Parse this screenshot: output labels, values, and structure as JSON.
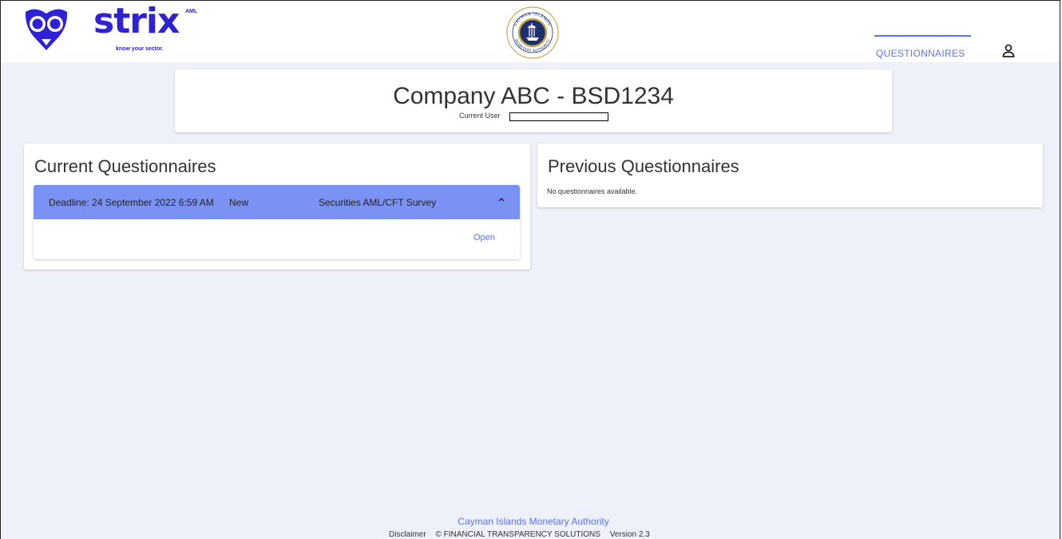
{
  "brand": {
    "name": "strix",
    "superscript": "AML",
    "tagline": "know your sector.",
    "color": "#2e21d6"
  },
  "seal": {
    "top_text": "CAYMAN ISLANDS",
    "bottom_text": "MONETARY AUTHORITY"
  },
  "nav": {
    "questionnaires_label": "QUESTIONNAIRES",
    "accent": "#5b73ea",
    "user_icon": "user-icon"
  },
  "company": {
    "title": "Company ABC - BSD1234",
    "current_user_label": "Current User"
  },
  "current": {
    "heading": "Current Questionnaires",
    "items": [
      {
        "deadline": "Deadline: 24 September 2022 6:59 AM",
        "status": "New",
        "type": "Securities AML/CFT Survey",
        "open_label": "Open",
        "header_color": "#7b92f5"
      }
    ]
  },
  "previous": {
    "heading": "Previous Questionnaires",
    "empty_text": "No questionnaires available."
  },
  "footer": {
    "authority": "Cayman Islands Monetary Authority",
    "disclaimer": "Disclaimer",
    "copyright": "© FINANCIAL TRANSPARENCY SOLUTIONS",
    "version": "Version 2.3"
  }
}
